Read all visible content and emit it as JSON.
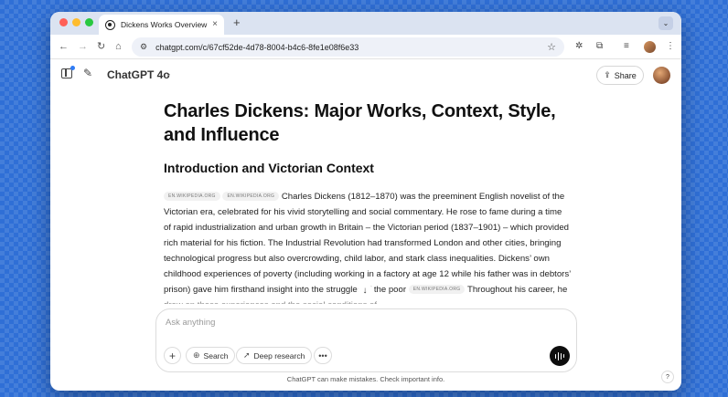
{
  "browser": {
    "tab_title": "Dickens Works Overview",
    "tab_close": "×",
    "new_tab": "+",
    "tab_menu": "⌄",
    "url": "chatgpt.com/c/67cf52de-4d78-8004-b4c6-8fe1e08f6e33",
    "colors": {
      "close": "#ff5f57",
      "minimize": "#febc2e",
      "maximize": "#28c840"
    }
  },
  "toolbar": {
    "back": "←",
    "forward": "→",
    "reload": "↻",
    "home": "⌂",
    "site_info": "⚙",
    "bookmark": "☆",
    "extension_a": "✲",
    "extension_b": "⧉",
    "media": "≡",
    "menu": "⋮"
  },
  "app": {
    "model": "ChatGPT 4o",
    "model_chevron": "⌄",
    "new_chat_icon": "✎",
    "share_label": "Share",
    "share_icon": "⇪"
  },
  "article": {
    "title": "Charles Dickens: Major Works, Context, Style, and Influence",
    "section_heading": "Introduction and Victorian Context",
    "citations": [
      "EN.WIKIPEDIA.ORG",
      "EN.WIKIPEDIA.ORG",
      "EN.WIKIPEDIA.ORG"
    ],
    "paragraph_part1": " Charles Dickens (1812–1870) was the preeminent English novelist of the Victorian era, celebrated for his vivid storytelling and social commentary. He rose to fame during a time of rapid industrialization and urban growth in Britain – the Victorian period (1837–1901) – which provided rich material for his fiction. The Industrial Revolution had transformed London and other cities, bringing technological progress but also overcrowding, child labor, and stark class inequalities. Dickens’ own childhood experiences of poverty (including working in a factory at age 12 while his father was in debtors’ prison) gave him firsthand insight into the struggles of the poor ",
    "paragraph_part2": " Throughout his career, he drew on these experiences and the social conditions of",
    "scroll_icon": "↓"
  },
  "composer": {
    "placeholder": "Ask anything",
    "plus": "+",
    "search_label": "Search",
    "search_icon": "⊕",
    "deep_research_label": "Deep research",
    "deep_research_icon": "➚",
    "more_icon": "•••"
  },
  "footer": {
    "disclaimer": "ChatGPT can make mistakes. Check important info.",
    "help": "?"
  }
}
